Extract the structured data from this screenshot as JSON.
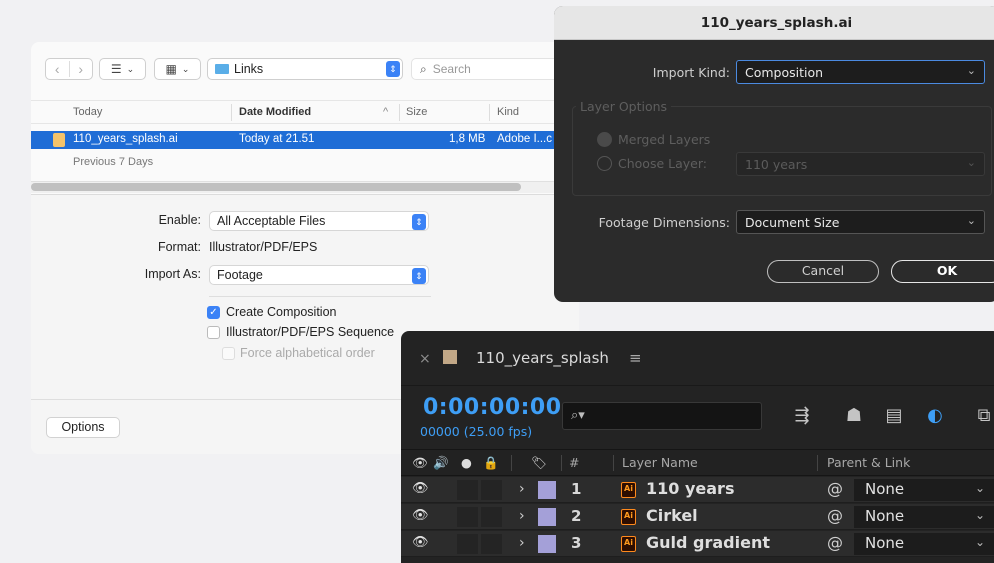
{
  "finder": {
    "location": "Links",
    "search_placeholder": "Search",
    "columns": {
      "name": "Today",
      "date": "Date Modified",
      "size": "Size",
      "kind": "Kind"
    },
    "selected_file": {
      "name": "110_years_splash.ai",
      "date": "Today at 21.51",
      "size": "1,8 MB",
      "kind": "Adobe I...c"
    },
    "section_previous": "Previous 7 Days",
    "enable_label": "Enable:",
    "enable_value": "All Acceptable Files",
    "format_label": "Format:",
    "format_value": "Illustrator/PDF/EPS",
    "import_as_label": "Import As:",
    "import_as_value": "Footage",
    "create_composition": "Create Composition",
    "sequence": "Illustrator/PDF/EPS Sequence",
    "force_alpha": "Force alphabetical order",
    "options_button": "Options"
  },
  "import_dialog": {
    "title": "110_years_splash.ai",
    "import_kind_label": "Import Kind:",
    "import_kind_value": "Composition",
    "layer_options_label": "Layer Options",
    "merged_layers": "Merged Layers",
    "choose_layer": "Choose Layer:",
    "choose_layer_value": "110 years",
    "footage_dimensions_label": "Footage Dimensions:",
    "footage_dimensions_value": "Document Size",
    "cancel": "Cancel",
    "ok": "OK"
  },
  "timeline": {
    "comp_name": "110_years_splash",
    "timecode": "0:00:00:00",
    "frame_info": "00000 (25.00 fps)",
    "search_placeholder": "",
    "headers": {
      "num": "#",
      "layer_name": "Layer Name",
      "parent": "Parent & Link"
    },
    "layers": [
      {
        "num": "1",
        "name": "110 years",
        "parent": "None"
      },
      {
        "num": "2",
        "name": "Cirkel",
        "parent": "None"
      },
      {
        "num": "3",
        "name": "Guld gradient",
        "parent": "None"
      }
    ],
    "label_color": "#a4a0d8",
    "accent": "#3e9ef5"
  }
}
